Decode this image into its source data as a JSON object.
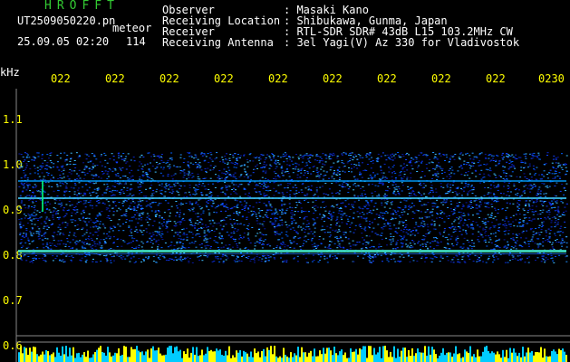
{
  "header": {
    "logo": "HROFFT",
    "filename": "UT2509050220.pn",
    "meteor_label": "meteor",
    "datetime": "25.09.05 02:20",
    "count": "114",
    "fields": [
      {
        "label": "Observer",
        "value": ": Masaki Kano"
      },
      {
        "label": "Receiving Location",
        "value": ": Shibukawa, Gunma, Japan"
      },
      {
        "label": "Receiver",
        "value": ": RTL-SDR SDR# 43dB L15 103.2MHz CW"
      },
      {
        "label": "Receiving Antenna",
        "value": ": 3el Yagi(V) Az 330 for Vladivostok"
      }
    ]
  },
  "axis": {
    "unit": "kHz",
    "time_ticks": [
      "022",
      "022",
      "022",
      "022",
      "022",
      "022",
      "022",
      "022",
      "022",
      "0230"
    ],
    "freq_ticks": [
      "1.1",
      "1.0",
      "0.9",
      "0.8",
      "0.7",
      "0.6"
    ]
  },
  "colors": {
    "label": "#ffffff",
    "tick": "#ffff00",
    "logo": "#33cc33",
    "echo": "#00ffff"
  }
}
